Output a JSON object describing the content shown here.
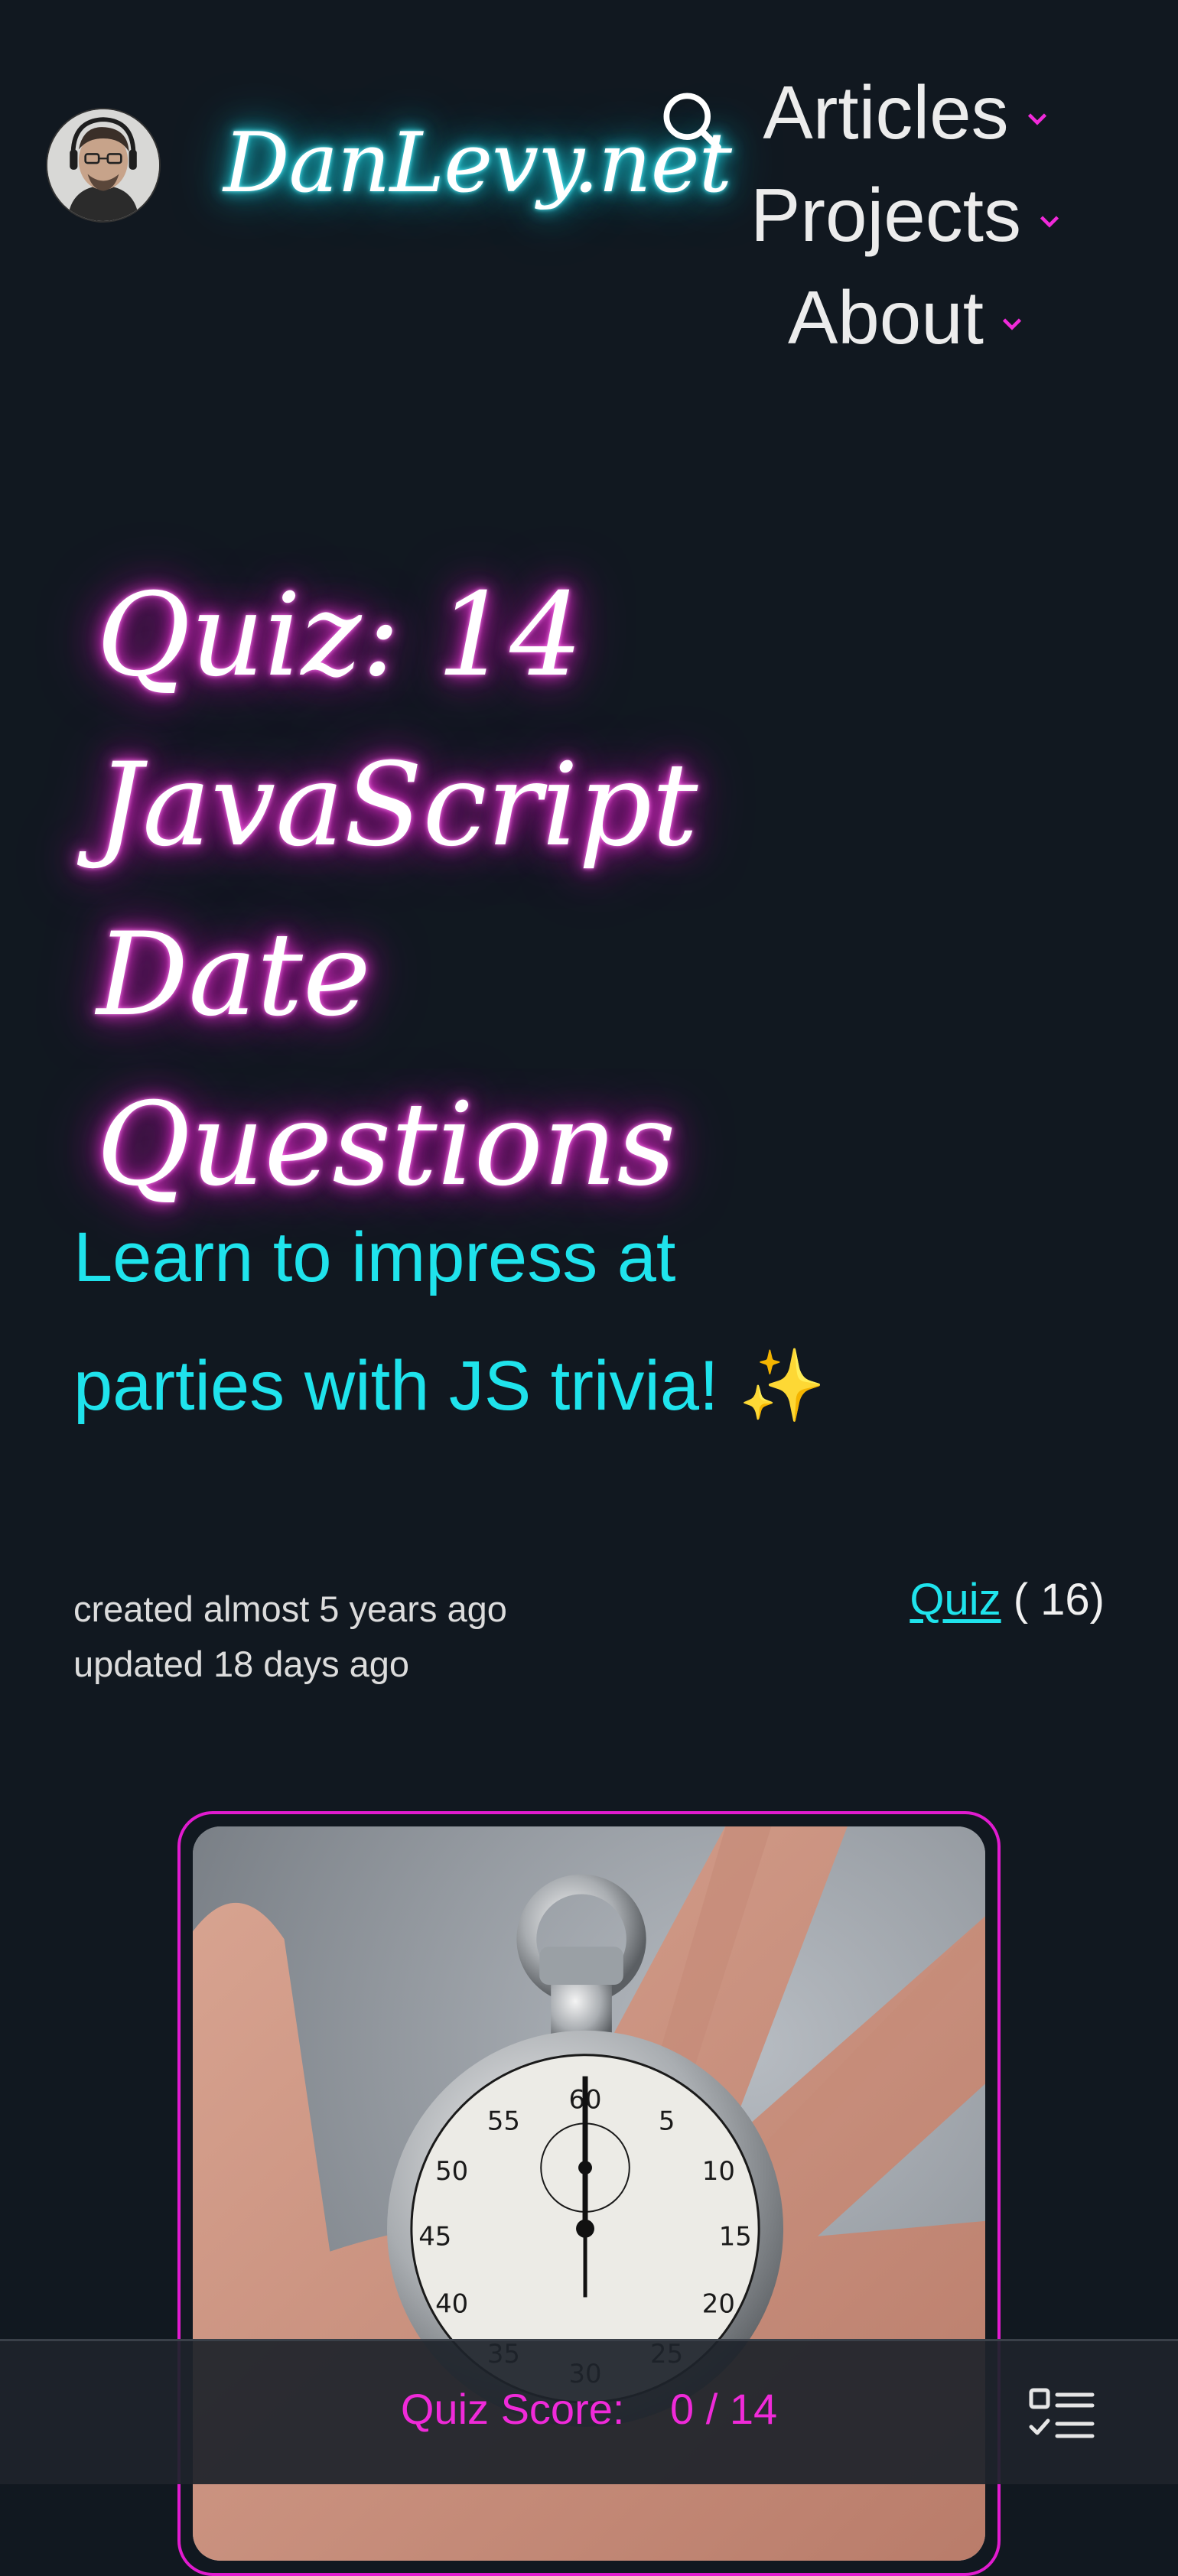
{
  "header": {
    "logo_text": "DanLevy.net",
    "avatar_alt": "avatar",
    "search_icon": "search-icon",
    "nav": [
      {
        "label": "Articles",
        "icon": "chevron-down-icon"
      },
      {
        "label": "Projects",
        "icon": "chevron-down-icon"
      },
      {
        "label": "About",
        "icon": "chevron-down-icon"
      }
    ]
  },
  "hero": {
    "title_lines": [
      "Quiz: 14",
      "JavaScript",
      "Date Questions"
    ],
    "subtitle_lines": [
      "Learn to impress at",
      "parties with JS trivia! ✨"
    ]
  },
  "meta": {
    "created": "created almost 5 years ago",
    "updated": "updated 18 days ago",
    "category_label": "Quiz",
    "category_count": "( 16)"
  },
  "image": {
    "subject": "stopwatch in hand"
  },
  "score_bar": {
    "label": "Quiz Score:",
    "value": "0 / 14",
    "toc_icon": "checklist-icon"
  },
  "colors": {
    "background": "#111820",
    "cyan_accent": "#1fe3ec",
    "magenta_accent": "#f02ad9",
    "frame_border": "#e11bcf"
  }
}
